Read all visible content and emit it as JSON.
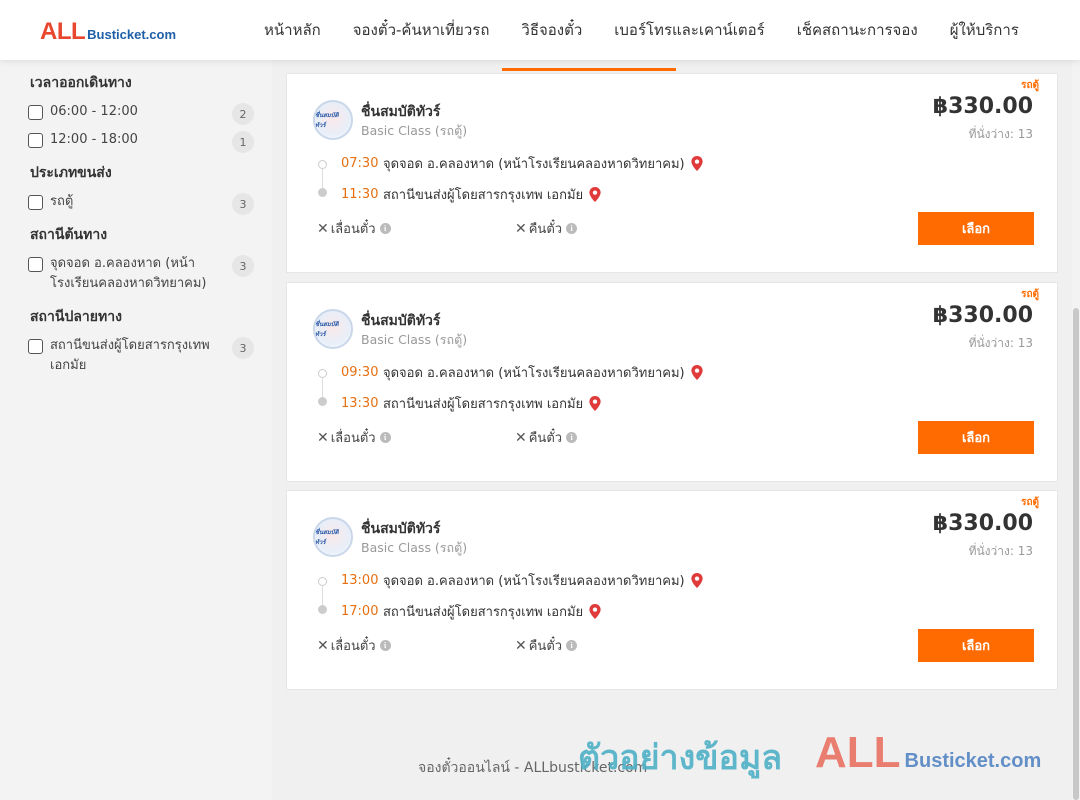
{
  "brand": {
    "logo_main": "ALL",
    "logo_rest": "Busticket.com"
  },
  "nav": [
    {
      "label": "หน้าหลัก"
    },
    {
      "label": "จองตั๋ว-ค้นหาเที่ยวรถ"
    },
    {
      "label": "วิธีจองตั๋ว"
    },
    {
      "label": "เบอร์โทรและเคาน์เตอร์"
    },
    {
      "label": "เช็คสถานะการจอง"
    },
    {
      "label": "ผู้ให้บริการ"
    }
  ],
  "filters": {
    "departure_time": {
      "title": "เวลาออกเดินทาง",
      "options": [
        {
          "label": "06:00 - 12:00",
          "count": "2"
        },
        {
          "label": "12:00 - 18:00",
          "count": "1"
        }
      ]
    },
    "transport_type": {
      "title": "ประเภทขนส่ง",
      "options": [
        {
          "label": "รถตู้",
          "count": "3"
        }
      ]
    },
    "origin": {
      "title": "สถานีต้นทาง",
      "options": [
        {
          "label": "จุดจอด อ.คลองหาด (หน้าโรงเรียนคลองหาดวิทยาคม)",
          "count": "3"
        }
      ]
    },
    "destination": {
      "title": "สถานีปลายทาง",
      "options": [
        {
          "label": "สถานีขนส่งผู้โดยสารกรุงเทพ เอกมัย",
          "count": "3"
        }
      ]
    }
  },
  "trips": [
    {
      "tag": "รถตู้",
      "logo_text": "ชื่นสมบัติ ทัวร์",
      "operator": "ชื่นสมบัติทัวร์",
      "class": "Basic Class (รถตู้)",
      "price": "฿330.00",
      "seats": "ที่นั่งว่าง: 13",
      "depart_time": "07:30",
      "depart_place": "จุดจอด อ.คลองหาด (หน้าโรงเรียนคลองหาดวิทยาคม)",
      "arrive_time": "11:30",
      "arrive_place": "สถานีขนส่งผู้โดยสารกรุงเทพ เอกมัย",
      "change_label": "เลื่อนตั๋ว",
      "refund_label": "คืนตั๋ว",
      "select_label": "เลือก"
    },
    {
      "tag": "รถตู้",
      "logo_text": "ชื่นสมบัติ ทัวร์",
      "operator": "ชื่นสมบัติทัวร์",
      "class": "Basic Class (รถตู้)",
      "price": "฿330.00",
      "seats": "ที่นั่งว่าง: 13",
      "depart_time": "09:30",
      "depart_place": "จุดจอด อ.คลองหาด (หน้าโรงเรียนคลองหาดวิทยาคม)",
      "arrive_time": "13:30",
      "arrive_place": "สถานีขนส่งผู้โดยสารกรุงเทพ เอกมัย",
      "change_label": "เลื่อนตั๋ว",
      "refund_label": "คืนตั๋ว",
      "select_label": "เลือก"
    },
    {
      "tag": "รถตู้",
      "logo_text": "ชื่นสมบัติ ทัวร์",
      "operator": "ชื่นสมบัติทัวร์",
      "class": "Basic Class (รถตู้)",
      "price": "฿330.00",
      "seats": "ที่นั่งว่าง: 13",
      "depart_time": "13:00",
      "depart_place": "จุดจอด อ.คลองหาด (หน้าโรงเรียนคลองหาดวิทยาคม)",
      "arrive_time": "17:00",
      "arrive_place": "สถานีขนส่งผู้โดยสารกรุงเทพ เอกมัย",
      "change_label": "เลื่อนตั๋ว",
      "refund_label": "คืนตั๋ว",
      "select_label": "เลือก"
    }
  ],
  "footer": {
    "text": "จองตั๋วออนไลน์ - ALLbusticket.com"
  },
  "watermark": {
    "text": "ตัวอย่างข้อมูล",
    "logo_main": "ALL",
    "logo_rest": "Busticket.com"
  },
  "colors": {
    "accent": "#ff6b00",
    "time": "#e76f10",
    "pin": "#e03b3b"
  }
}
